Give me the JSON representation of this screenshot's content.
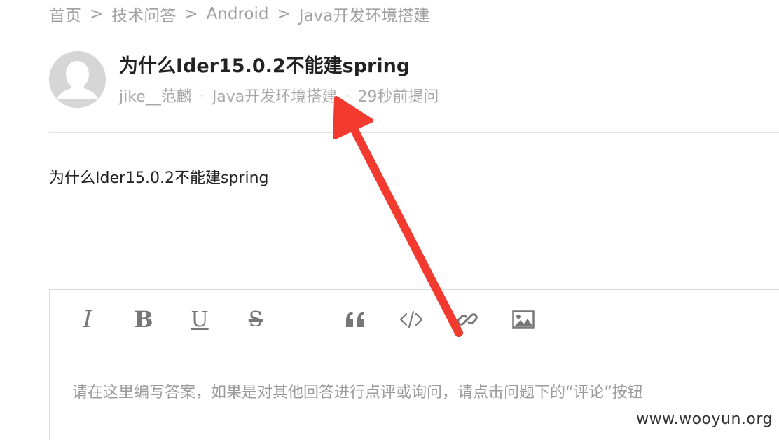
{
  "breadcrumb": {
    "items": [
      "首页",
      "技术问答",
      "Android",
      "Java开发环境搭建"
    ],
    "separator": ">"
  },
  "question": {
    "title": "为什么Ider15.0.2不能建spring",
    "author": "jike__范麟",
    "category": "Java开发环境搭建",
    "time": "29秒前提问",
    "meta_separator": "·",
    "body": "为什么Ider15.0.2不能建spring"
  },
  "editor": {
    "toolbar": {
      "italic": "I",
      "bold": "B",
      "underline": "U",
      "strikethrough": "S"
    },
    "placeholder": "请在这里编写答案，如果是对其他回答进行点评或询问，请点击问题下的“评论”按钮"
  },
  "watermark": "www.wooyun.org",
  "colors": {
    "arrow": "#f23a2f",
    "meta_text": "#a8a8a8",
    "editor_border": "#cfdede"
  }
}
